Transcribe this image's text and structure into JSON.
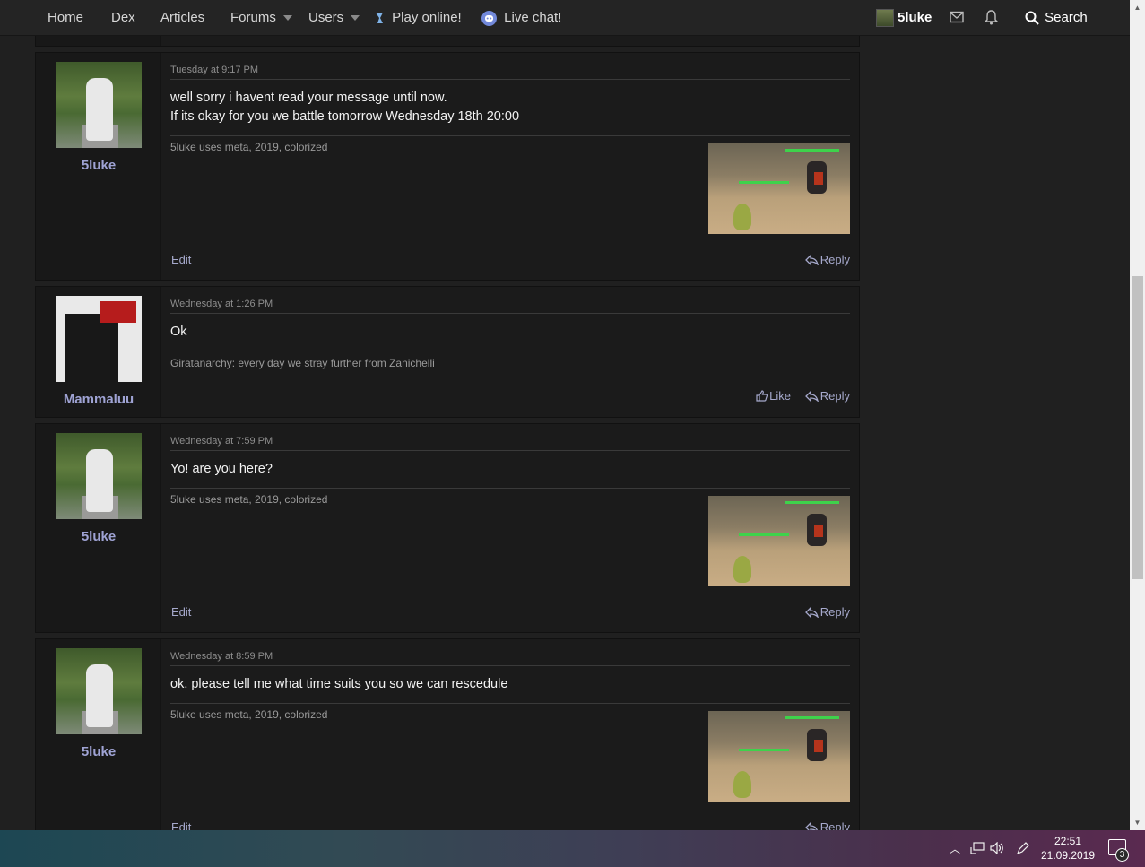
{
  "nav": {
    "home": "Home",
    "dex": "Dex",
    "articles": "Articles",
    "forums": "Forums",
    "users": "Users",
    "play_online": "Play online!",
    "live_chat": "Live chat!",
    "username": "5luke",
    "search": "Search"
  },
  "posts": [
    {
      "username": "5luke",
      "date": "Tuesday at 9:17 PM",
      "message_lines": [
        "well sorry i havent read your message until now.",
        "If its okay for you we battle tomorrow Wednesday 18th 20:00"
      ],
      "signature": "5luke uses meta, 2019, colorized",
      "actions": {
        "edit": "Edit",
        "reply": "Reply"
      }
    },
    {
      "username": "Mammaluu",
      "date": "Wednesday at 1:26 PM",
      "message_lines": [
        "Ok"
      ],
      "signature": "Giratanarchy: every day we stray further from Zanichelli",
      "actions": {
        "like": "Like",
        "reply": "Reply"
      }
    },
    {
      "username": "5luke",
      "date": "Wednesday at 7:59 PM",
      "message_lines": [
        "Yo! are you here?"
      ],
      "signature": "5luke uses meta, 2019, colorized",
      "actions": {
        "edit": "Edit",
        "reply": "Reply"
      }
    },
    {
      "username": "5luke",
      "date": "Wednesday at 8:59 PM",
      "message_lines": [
        "ok. please tell me what time suits you so we can rescedule"
      ],
      "signature": "5luke uses meta, 2019, colorized",
      "actions": {
        "edit": "Edit",
        "reply": "Reply"
      }
    }
  ],
  "taskbar": {
    "time": "22:51",
    "date": "21.09.2019",
    "notification_count": "3"
  },
  "colors": {
    "background": "#202020",
    "username": "#9fa3d4",
    "link": "#a6a9cc"
  }
}
